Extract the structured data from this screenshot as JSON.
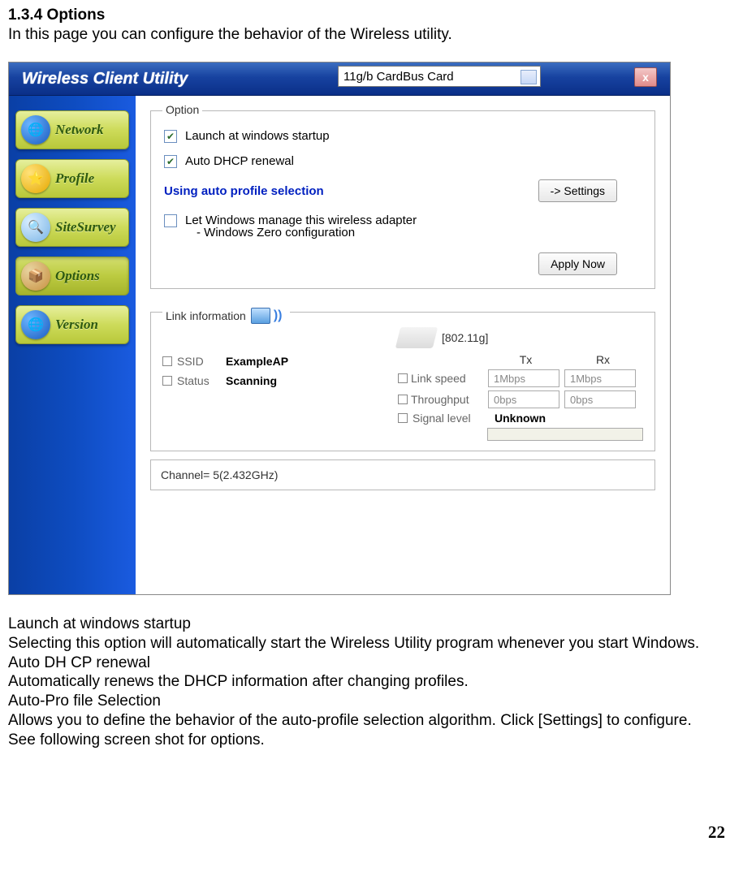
{
  "doc": {
    "heading": "1.3.4 Options",
    "intro": "In this page you can configure the behavior of the Wireless utility.",
    "desc_lines": [
      "Launch at windows startup",
      "Selecting this option will automatically start the Wireless Utility program whenever you start Windows.",
      "Auto DH CP renewal",
      "Automatically renews the DHCP information after changing profiles.",
      "Auto-Pro file Selection",
      "Allows you to define the behavior of the auto-profile selection algorithm. Click [Settings] to configure.",
      "See following screen shot for options."
    ],
    "page_number": "22"
  },
  "titlebar": {
    "title": "Wireless Client Utility",
    "card": "11g/b CardBus Card",
    "close": "x"
  },
  "sidebar": {
    "items": [
      {
        "label": "Network"
      },
      {
        "label": "Profile"
      },
      {
        "label": "SiteSurvey"
      },
      {
        "label": "Options"
      },
      {
        "label": "Version"
      }
    ]
  },
  "option": {
    "group_title": "Option",
    "launch": "Launch at windows startup",
    "dhcp": "Auto DHCP renewal",
    "auto_profile": "Using auto profile selection",
    "settings_btn": "-> Settings",
    "let_windows": "Let Windows manage this wireless adapter",
    "zero_conf": "- Windows Zero configuration",
    "apply_btn": "Apply Now"
  },
  "link": {
    "group_title": "Link information",
    "ssid_label": "SSID",
    "ssid_value": "ExampleAP",
    "status_label": "Status",
    "status_value": "Scanning",
    "mode": "[802.11g]",
    "tx": "Tx",
    "rx": "Rx",
    "linkspeed_label": "Link speed",
    "linkspeed_tx": "1Mbps",
    "linkspeed_rx": "1Mbps",
    "throughput_label": "Throughput",
    "throughput_tx": "0bps",
    "throughput_rx": "0bps",
    "signal_label": "Signal level",
    "signal_value": "Unknown"
  },
  "channel": {
    "text": "Channel= 5(2.432GHz)"
  }
}
